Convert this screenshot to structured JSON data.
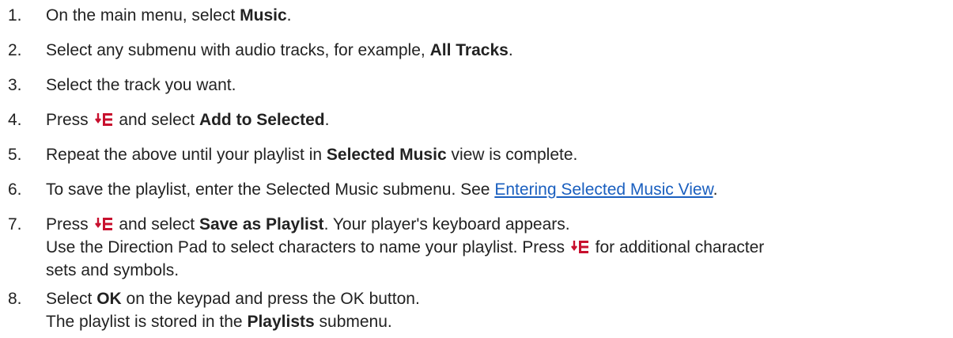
{
  "steps": [
    {
      "num": "1.",
      "lines": [
        {
          "a": "On the main menu, select ",
          "b": "Music",
          "c": "."
        }
      ]
    },
    {
      "num": "2.",
      "lines": [
        {
          "a": "Select any submenu with audio tracks, for example, ",
          "b": "All Tracks",
          "c": "."
        }
      ]
    },
    {
      "num": "3.",
      "lines": [
        {
          "a": "Select the track you want."
        }
      ]
    },
    {
      "num": "4.",
      "lines": [
        {
          "a": "Press",
          "icon": "menu-icon",
          "b_pre": " and select ",
          "b": "Add to Selected",
          "c": "."
        }
      ]
    },
    {
      "num": "5.",
      "lines": [
        {
          "a": "Repeat the above until your playlist in ",
          "b": "Selected Music",
          "c": " view is complete."
        }
      ]
    },
    {
      "num": "6.",
      "lines": [
        {
          "a": "To save the playlist, enter the Selected Music submenu. See ",
          "link": "Entering Selected Music View",
          "c": "."
        }
      ]
    },
    {
      "num": "7.",
      "lines": [
        {
          "a": "Press",
          "icon": "menu-icon",
          "b_pre": " and select ",
          "b": "Save as Playlist",
          "c": ". Your player's keyboard appears."
        },
        {
          "a": "Use the Direction Pad to select characters to name your playlist. Press",
          "icon": "menu-icon",
          "c": " for additional character"
        },
        {
          "a": "sets and symbols."
        }
      ]
    },
    {
      "num": "8.",
      "lines": [
        {
          "a": "Select ",
          "b": "OK",
          "c": " on the keypad and press the OK button."
        },
        {
          "a": "The playlist is stored in the ",
          "b": "Playlists",
          "c": " submenu."
        }
      ]
    }
  ],
  "colors": {
    "text": "#222222",
    "link": "#1a5fbf",
    "icon": "#c8102e"
  }
}
